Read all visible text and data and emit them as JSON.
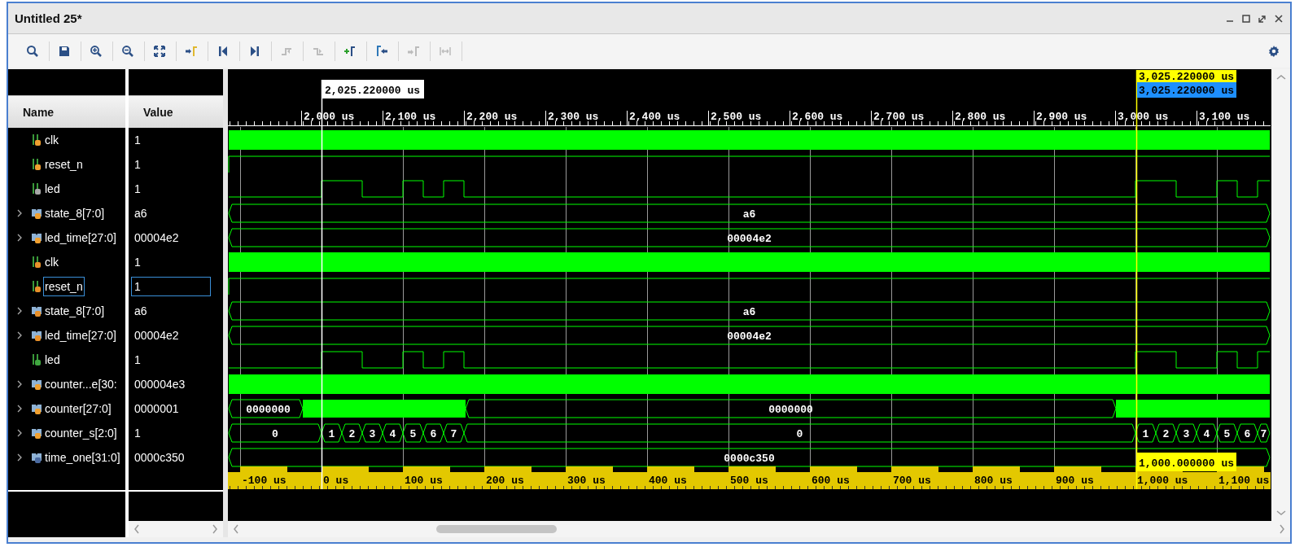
{
  "window": {
    "title": "Untitled 25*"
  },
  "toolbar": [
    {
      "kind": "search",
      "disabled": false
    },
    {
      "kind": "save",
      "disabled": false
    },
    {
      "kind": "zoom-in",
      "disabled": false
    },
    {
      "kind": "zoom-out",
      "disabled": false
    },
    {
      "kind": "fit",
      "disabled": false
    },
    {
      "kind": "goto-cursor",
      "disabled": false
    },
    {
      "kind": "first",
      "disabled": false
    },
    {
      "kind": "last",
      "disabled": false
    },
    {
      "kind": "prev-edge",
      "disabled": true
    },
    {
      "kind": "next-edge",
      "disabled": true
    },
    {
      "kind": "add-marker",
      "disabled": false
    },
    {
      "kind": "prev-marker",
      "disabled": false
    },
    {
      "kind": "next-marker",
      "disabled": true
    },
    {
      "kind": "swap",
      "disabled": true
    }
  ],
  "columns": [
    "Name",
    "Value"
  ],
  "signals": [
    {
      "name": "clk",
      "value": "1",
      "expandable": false,
      "kind": "clock",
      "selected": false
    },
    {
      "name": "reset_n",
      "value": "1",
      "expandable": false,
      "kind": "step",
      "selected": false
    },
    {
      "name": "led",
      "value": "1",
      "expandable": false,
      "kind": "pulse",
      "selected": false
    },
    {
      "name": "state_8[7:0]",
      "value": "a6",
      "expandable": true,
      "kind": "bus",
      "selected": false,
      "labels": [
        "a6"
      ]
    },
    {
      "name": "led_time[27:0]",
      "value": "00004e2",
      "expandable": true,
      "kind": "bus",
      "selected": false,
      "labels": [
        "00004e2"
      ]
    },
    {
      "name": "clk",
      "value": "1",
      "expandable": false,
      "kind": "clock",
      "selected": false
    },
    {
      "name": "reset_n",
      "value": "1",
      "expandable": false,
      "kind": "step",
      "selected": true
    },
    {
      "name": "state_8[7:0]",
      "value": "a6",
      "expandable": true,
      "kind": "bus",
      "selected": false,
      "labels": [
        "a6"
      ]
    },
    {
      "name": "led_time[27:0]",
      "value": "00004e2",
      "expandable": true,
      "kind": "bus",
      "selected": false,
      "labels": [
        "00004e2"
      ]
    },
    {
      "name": "led",
      "value": "1",
      "expandable": false,
      "kind": "pulse",
      "selected": false
    },
    {
      "name": "counter...e[30:",
      "value": "000004e3",
      "expandable": true,
      "kind": "dense",
      "selected": false
    },
    {
      "name": "counter[27:0]",
      "value": "0000001",
      "expandable": true,
      "kind": "busy",
      "selected": false,
      "labels": [
        "0000000",
        "0000000"
      ]
    },
    {
      "name": "counter_s[2:0]",
      "value": "1",
      "expandable": true,
      "kind": "count",
      "selected": false,
      "labels": [
        "0",
        "1",
        "2",
        "3",
        "4",
        "5",
        "6",
        "7",
        "0",
        "1",
        "2",
        "3",
        "4",
        "5",
        "6",
        "7"
      ]
    },
    {
      "name": "time_one[31:0]",
      "value": "0000c350",
      "expandable": true,
      "kind": "bus",
      "selected": false,
      "labels": [
        "0000c350"
      ]
    }
  ],
  "cursors": {
    "main": "2,025.220000 us",
    "marker": "3,025.220000 us",
    "marker_alt": "3,025.220000 us",
    "delta": "1,000.000000 us"
  },
  "ruler": [
    "2,000 us",
    "2,100 us",
    "2,200 us",
    "2,300 us",
    "2,400 us",
    "2,500 us",
    "2,600 us",
    "2,700 us",
    "2,800 us",
    "2,900 us",
    "3,000 us",
    "3,100 us"
  ],
  "scale": [
    "-100 us",
    "0 us",
    "100 us",
    "200 us",
    "300 us",
    "400 us",
    "500 us",
    "600 us",
    "700 us",
    "800 us",
    "900 us",
    "1,000 us",
    "1,100 us"
  ]
}
